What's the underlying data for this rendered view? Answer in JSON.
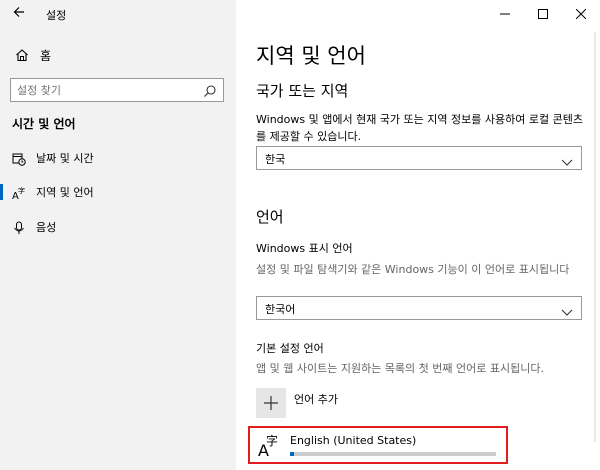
{
  "app": {
    "title": "설정"
  },
  "sidebar": {
    "home_label": "홈",
    "search_placeholder": "설정 찾기",
    "section_title": "시간 및 언어",
    "items": [
      {
        "label": "날짜 및 시간",
        "icon": "calendar-clock-icon",
        "selected": false
      },
      {
        "label": "지역 및 언어",
        "icon": "language-icon",
        "selected": true
      },
      {
        "label": "음성",
        "icon": "microphone-icon",
        "selected": false
      }
    ]
  },
  "main": {
    "title": "지역 및 언어",
    "region": {
      "heading": "국가 또는 지역",
      "description": "Windows 및 앱에서 현재 국가 또는 지역 정보를 사용하여 로컬 콘텐츠를 제공할 수 있습니다.",
      "selected": "한국"
    },
    "language": {
      "heading": "언어",
      "display_label": "Windows 표시 언어",
      "display_description": "설정 및 파일 탐색기와 같은 Windows 기능이 이 언어로 표시됩니다",
      "display_selected": "한국어",
      "preferred_label": "기본 설정 언어",
      "preferred_description": "앱 및 웹 사이트는 지원하는 목록의 첫 번째 언어로 표시됩니다.",
      "add_label": "언어 추가",
      "entries": [
        {
          "name": "English (United States)",
          "icon_letters": {
            "latin": "A",
            "cjk": "字"
          },
          "progress": 0.02
        }
      ]
    }
  },
  "colors": {
    "accent": "#0067c0",
    "highlight_border": "#e11d1d",
    "sidebar_bg": "#f2f2f2"
  }
}
